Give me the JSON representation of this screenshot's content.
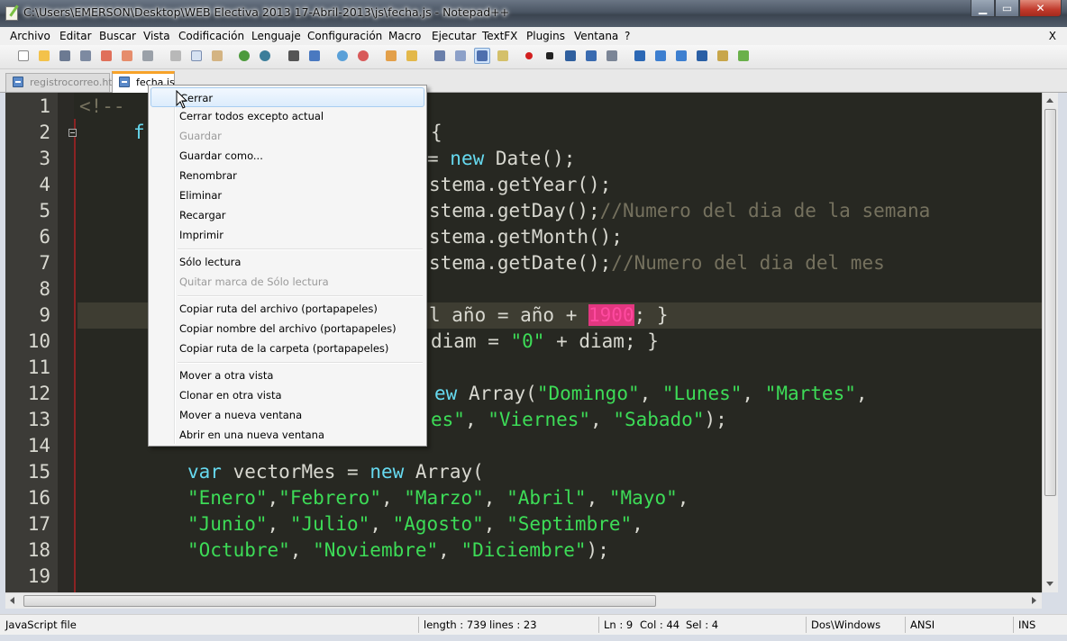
{
  "window": {
    "title": "C:\\Users\\EMERSON\\Desktop\\WEB Electiva 2013 17-Abril-2013\\js\\fecha.js - Notepad++",
    "minimize": "▁",
    "maximize": "▭",
    "close": "✕"
  },
  "menubar": {
    "items": [
      "Archivo",
      "Editar",
      "Buscar",
      "Vista",
      "Codificación",
      "Lenguaje",
      "Configuración",
      "Macro",
      "Ejecutar",
      "TextFX",
      "Plugins",
      "Ventana",
      "?"
    ],
    "close_doc": "X"
  },
  "tabs": [
    {
      "label": "registrocorreo.html"
    },
    {
      "label": "fecha.js"
    }
  ],
  "editor": {
    "line_numbers": [
      "1",
      "2",
      "3",
      "4",
      "5",
      "6",
      "7",
      "8",
      "9",
      "10",
      "11",
      "12",
      "13",
      "14",
      "15",
      "16",
      "17",
      "18",
      "19"
    ],
    "code": {
      "l1": "<!--",
      "l2a": "f",
      "l2b": "{",
      "l3a": "= ",
      "l3b": "new",
      "l3c": " Date();",
      "l4": "stema.getYear();",
      "l5a": "stema.getDay();",
      "l5b": "//Numero del dia de la semana",
      "l6": "stema.getMonth();",
      "l7a": "stema.getDate();",
      "l7b": "//Numero del dia del mes",
      "l9a": "l año = año + ",
      "l9b": "1900",
      "l9c": "; }",
      "l10a": "diam = ",
      "l10b": "\"0\"",
      "l10c": " + diam; }",
      "l12a": "ew",
      "l12b": " Array(",
      "l12c": "\"Domingo\"",
      "l12d": ", ",
      "l12e": "\"Lunes\"",
      "l12f": ", ",
      "l12g": "\"Martes\"",
      "l12h": ",",
      "l13a": "es\"",
      "l13b": ", ",
      "l13c": "\"Viernes\"",
      "l13d": ", ",
      "l13e": "\"Sabado\"",
      "l13f": ");",
      "l15a": "var",
      "l15b": " vectorMes = ",
      "l15c": "new",
      "l15d": " Array(",
      "l16a": "\"Enero\"",
      "l16b": ",",
      "l16c": "\"Febrero\"",
      "l16d": ", ",
      "l16e": "\"Marzo\"",
      "l16f": ", ",
      "l16g": "\"Abril\"",
      "l16h": ", ",
      "l16i": "\"Mayo\"",
      "l16j": ",",
      "l17a": "\"Junio\"",
      "l17b": ", ",
      "l17c": "\"Julio\"",
      "l17d": ", ",
      "l17e": "\"Agosto\"",
      "l17f": ", ",
      "l17g": "\"Septimbre\"",
      "l17h": ",",
      "l18a": "\"Octubre\"",
      "l18b": ", ",
      "l18c": "\"Noviembre\"",
      "l18d": ", ",
      "l18e": "\"Diciembre\"",
      "l18f": ");"
    }
  },
  "context_menu": {
    "items": [
      {
        "label": "Cerrar",
        "enabled": true,
        "highlighted": true
      },
      {
        "label": "Cerrar todos excepto actual",
        "enabled": true
      },
      {
        "label": "Guardar",
        "enabled": false
      },
      {
        "label": "Guardar como...",
        "enabled": true
      },
      {
        "label": "Renombrar",
        "enabled": true
      },
      {
        "label": "Eliminar",
        "enabled": true
      },
      {
        "label": "Recargar",
        "enabled": true
      },
      {
        "label": "Imprimir",
        "enabled": true
      },
      {
        "label": "Sólo lectura",
        "enabled": true
      },
      {
        "label": "Quitar marca de Sólo lectura",
        "enabled": false
      },
      {
        "label": "Copiar ruta del archivo (portapapeles)",
        "enabled": true
      },
      {
        "label": "Copiar nombre del archivo (portapapeles)",
        "enabled": true
      },
      {
        "label": "Copiar ruta de la carpeta (portapapeles)",
        "enabled": true
      },
      {
        "label": "Mover a otra vista",
        "enabled": true
      },
      {
        "label": "Clonar en otra vista",
        "enabled": true
      },
      {
        "label": "Mover a nueva ventana",
        "enabled": true
      },
      {
        "label": "Abrir en una nueva ventana",
        "enabled": true
      }
    ]
  },
  "statusbar": {
    "file_type": "JavaScript file",
    "length": "length : 739",
    "lines": "lines : 23",
    "ln": "Ln : 9",
    "col": "Col : 44",
    "sel": "Sel : 4",
    "eol": "Dos\\Windows",
    "encoding": "ANSI",
    "mode": "INS"
  },
  "colors": {
    "editor_bg": "#272822",
    "keyword": "#66d9ef",
    "string": "#3ddc57",
    "comment": "#75715e",
    "number_highlight": "#e23780",
    "tab_accent": "#f7a229"
  }
}
